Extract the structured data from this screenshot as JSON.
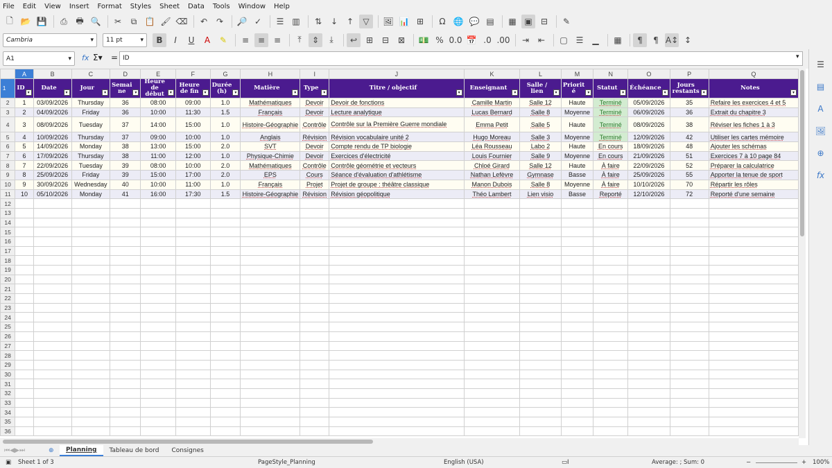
{
  "menu": [
    "File",
    "Edit",
    "View",
    "Insert",
    "Format",
    "Styles",
    "Sheet",
    "Data",
    "Tools",
    "Window",
    "Help"
  ],
  "font": {
    "name": "Cambria",
    "size": "11 pt"
  },
  "namebox": "A1",
  "formula": "ID",
  "colors": {
    "header_bg": "#4b1b8f",
    "header_text": "#ffffff",
    "odd_row": "#fffdf2",
    "even_row": "#ececf6",
    "done_bg": "#d3ecd1",
    "selection": "#3c7fd6"
  },
  "columns": [
    "A",
    "B",
    "C",
    "D",
    "E",
    "F",
    "G",
    "H",
    "I",
    "J",
    "K",
    "L",
    "M",
    "N",
    "O",
    "P",
    "Q"
  ],
  "headers": [
    "ID",
    "Date",
    "Jour",
    "Semai ne",
    "Heure de début",
    "Heure de fin",
    "Durée (h)",
    "Matière",
    "Type",
    "Titre / objectif",
    "Enseignant",
    "Salle / lien",
    "Priorit é",
    "Statut",
    "Échéance",
    "Jours restants",
    "Notes"
  ],
  "rows": [
    [
      "1",
      "03/09/2026",
      "Thursday",
      "36",
      "08:00",
      "09:00",
      "1.0",
      "Mathématiques",
      "Devoir",
      "Devoir de fonctions",
      "Camille Martin",
      "Salle 12",
      "Haute",
      "Terminé",
      "05/09/2026",
      "35",
      "Refaire les exercices 4 et 5"
    ],
    [
      "2",
      "04/09/2026",
      "Friday",
      "36",
      "10:00",
      "11:30",
      "1.5",
      "Français",
      "Devoir",
      "Lecture analytique",
      "Lucas Bernard",
      "Salle 8",
      "Moyenne",
      "Terminé",
      "06/09/2026",
      "36",
      "Extrait du chapitre 3"
    ],
    [
      "3",
      "08/09/2026",
      "Tuesday",
      "37",
      "14:00",
      "15:00",
      "1.0",
      "Histoire-Géographie",
      "Contrôle",
      "Contrôle sur la Première Guerre mondiale",
      "Emma Petit",
      "Salle 5",
      "Haute",
      "Terminé",
      "08/09/2026",
      "38",
      "Réviser les fiches 1 à 3"
    ],
    [
      "4",
      "10/09/2026",
      "Thursday",
      "37",
      "09:00",
      "10:00",
      "1.0",
      "Anglais",
      "Révision",
      "Révision vocabulaire unité 2",
      "Hugo Moreau",
      "Salle 3",
      "Moyenne",
      "Terminé",
      "12/09/2026",
      "42",
      "Utiliser les cartes mémoire"
    ],
    [
      "5",
      "14/09/2026",
      "Monday",
      "38",
      "13:00",
      "15:00",
      "2.0",
      "SVT",
      "Devoir",
      "Compte rendu de TP biologie",
      "Léa Rousseau",
      "Labo 2",
      "Haute",
      "En cours",
      "18/09/2026",
      "48",
      "Ajouter les schémas"
    ],
    [
      "6",
      "17/09/2026",
      "Thursday",
      "38",
      "11:00",
      "12:00",
      "1.0",
      "Physique-Chimie",
      "Devoir",
      "Exercices d'électricité",
      "Louis Fournier",
      "Salle 9",
      "Moyenne",
      "En cours",
      "21/09/2026",
      "51",
      "Exercices 7 à 10 page 84"
    ],
    [
      "7",
      "22/09/2026",
      "Tuesday",
      "39",
      "08:00",
      "10:00",
      "2.0",
      "Mathématiques",
      "Contrôle",
      "Contrôle géométrie et vecteurs",
      "Chloé Girard",
      "Salle 12",
      "Haute",
      "À faire",
      "22/09/2026",
      "52",
      "Préparer la calculatrice"
    ],
    [
      "8",
      "25/09/2026",
      "Friday",
      "39",
      "15:00",
      "17:00",
      "2.0",
      "EPS",
      "Cours",
      "Séance d'évaluation d'athlétisme",
      "Nathan Lefèvre",
      "Gymnase",
      "Basse",
      "À faire",
      "25/09/2026",
      "55",
      "Apporter la tenue de sport"
    ],
    [
      "9",
      "30/09/2026",
      "Wednesday",
      "40",
      "10:00",
      "11:00",
      "1.0",
      "Français",
      "Projet",
      "Projet de groupe : théâtre classique",
      "Manon Dubois",
      "Salle 8",
      "Moyenne",
      "À faire",
      "10/10/2026",
      "70",
      "Répartir les rôles"
    ],
    [
      "10",
      "05/10/2026",
      "Monday",
      "41",
      "16:00",
      "17:30",
      "1.5",
      "Histoire-Géographie",
      "Révision",
      "Révision géopolitique",
      "Théo Lambert",
      "Lien visio",
      "Basse",
      "Reporté",
      "12/10/2026",
      "72",
      "Reporté d'une semaine"
    ]
  ],
  "empty_row_start": 12,
  "empty_row_end": 36,
  "tabs": [
    "Planning",
    "Tableau de bord",
    "Consignes"
  ],
  "status": {
    "sheet": "Sheet 1 of 3",
    "page_style": "PageStyle_Planning",
    "language": "English (USA)",
    "sum": "Average: ; Sum: 0",
    "zoom": "100%"
  }
}
